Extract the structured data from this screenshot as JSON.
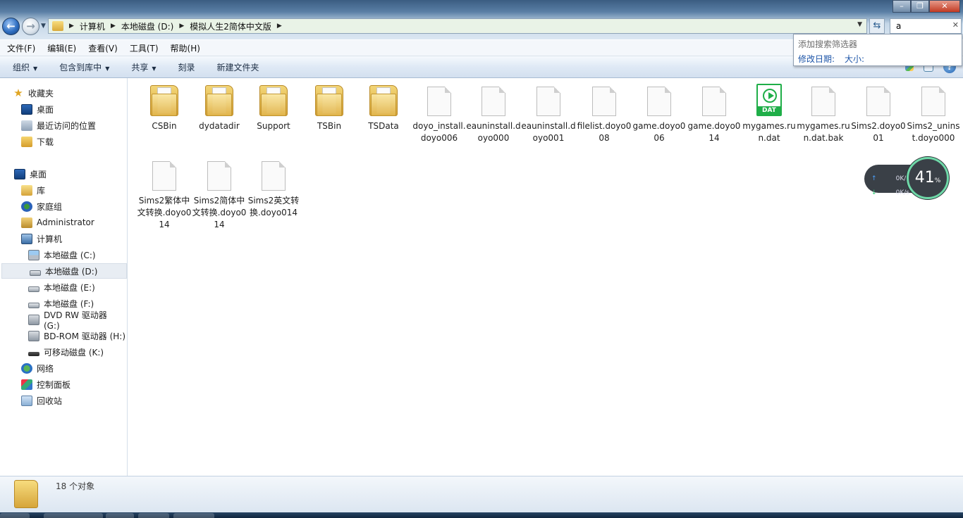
{
  "address": {
    "crumbs": [
      "计算机",
      "本地磁盘 (D:)",
      "模拟人生2简体中文版"
    ]
  },
  "search": {
    "value": "a",
    "dropdown_header": "添加搜索筛选器",
    "filter_date": "修改日期:",
    "filter_size": "大小:"
  },
  "menu": [
    "文件(F)",
    "编辑(E)",
    "查看(V)",
    "工具(T)",
    "帮助(H)"
  ],
  "commands": {
    "organize": "组织",
    "include_library": "包含到库中",
    "share": "共享",
    "burn": "刻录",
    "new_folder": "新建文件夹"
  },
  "nav": {
    "favorites": "收藏夹",
    "fav_desktop": "桌面",
    "fav_recent": "最近访问的位置",
    "fav_downloads": "下载",
    "desktop": "桌面",
    "libraries": "库",
    "homegroup": "家庭组",
    "administrator": "Administrator",
    "computer": "计算机",
    "drive_c": "本地磁盘 (C:)",
    "drive_d": "本地磁盘 (D:)",
    "drive_e": "本地磁盘 (E:)",
    "drive_f": "本地磁盘 (F:)",
    "drive_g": "DVD RW 驱动器 (G:)",
    "drive_h": "BD-ROM 驱动器 (H:)",
    "drive_k": "可移动磁盘 (K:)",
    "network": "网络",
    "control_panel": "控制面板",
    "recycle_bin": "回收站"
  },
  "files": {
    "f1": "CSBin",
    "f2": "dydatadir",
    "f3": "Support",
    "f4": "TSBin",
    "f5": "TSData",
    "f6": "doyo_install.doyo006",
    "f7": "eauninstall.doyo000",
    "f8": "eauninstall.doyo001",
    "f9": "filelist.doyo008",
    "f10": "game.doyo006",
    "f11": "game.doyo014",
    "f12": "mygames.run.dat",
    "f13": "mygames.run.dat.bak",
    "f14": "Sims2.doyo001",
    "f15": "Sims2_uninst.doyo000",
    "f16": "Sims2繁体中文转换.doyo014",
    "f17": "Sims2简体中文转换.doyo014",
    "f18": "Sims2英文转换.doyo014",
    "dat_badge": "DAT"
  },
  "widget": {
    "upload": "0K/s",
    "download": "0K/s",
    "percent": "41",
    "percent_unit": "%"
  },
  "status": {
    "count": "18 个对象"
  }
}
